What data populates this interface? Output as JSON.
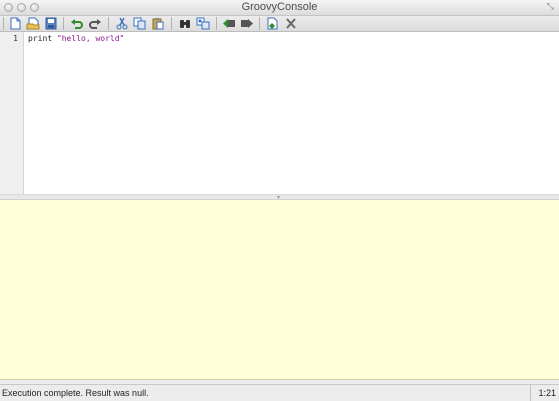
{
  "window": {
    "title": "GroovyConsole",
    "resize_icon": "resize-icon"
  },
  "toolbar": {
    "buttons": [
      {
        "name": "new-file",
        "icon": "new-document-icon"
      },
      {
        "name": "open-file",
        "icon": "open-folder-icon"
      },
      {
        "name": "save-file",
        "icon": "save-icon"
      },
      {
        "name": "undo",
        "icon": "undo-icon"
      },
      {
        "name": "redo",
        "icon": "redo-icon"
      },
      {
        "name": "cut",
        "icon": "cut-icon"
      },
      {
        "name": "copy",
        "icon": "copy-icon"
      },
      {
        "name": "paste",
        "icon": "paste-icon"
      },
      {
        "name": "find",
        "icon": "binoculars-icon"
      },
      {
        "name": "replace",
        "icon": "replace-icon"
      },
      {
        "name": "history-previous",
        "icon": "history-back-icon"
      },
      {
        "name": "history-next",
        "icon": "history-forward-icon"
      },
      {
        "name": "run-script",
        "icon": "run-icon"
      },
      {
        "name": "interrupt-script",
        "icon": "interrupt-icon"
      }
    ]
  },
  "editor": {
    "line_numbers": [
      "1"
    ],
    "code_keyword": "print",
    "code_string": "\"hello, world\""
  },
  "output": {
    "text": ""
  },
  "status": {
    "message": "Execution complete. Result was null.",
    "caret_position": "1:21"
  },
  "colors": {
    "output_background": "#ffffd9",
    "string_literal": "#8a1a8a",
    "toolbar_icon_blue": "#3a6fbf"
  }
}
